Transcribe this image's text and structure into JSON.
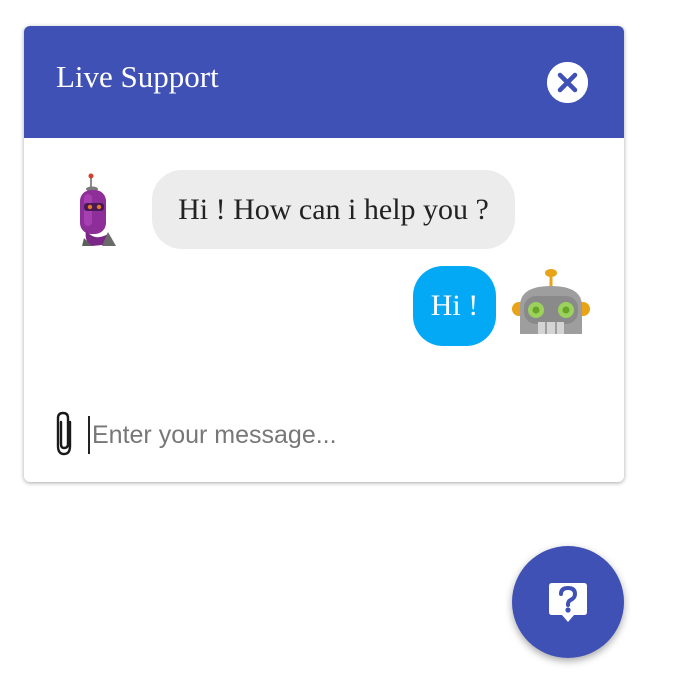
{
  "chat": {
    "title": "Live Support",
    "close_icon": "close-circle-icon",
    "messages": [
      {
        "sender": "bot",
        "text": "Hi ! How can i help you ?",
        "avatar": "purple-robot-avatar"
      },
      {
        "sender": "user",
        "text": "Hi !",
        "avatar": "gray-robot-avatar"
      }
    ],
    "input": {
      "placeholder": "Enter your message...",
      "value": "",
      "attach_icon": "paperclip-icon"
    }
  },
  "fab": {
    "icon": "help-question-icon"
  },
  "colors": {
    "header": "#3f51b5",
    "bot_bubble": "#ececec",
    "user_bubble": "#03a9f4",
    "fab": "#3f51b5"
  }
}
